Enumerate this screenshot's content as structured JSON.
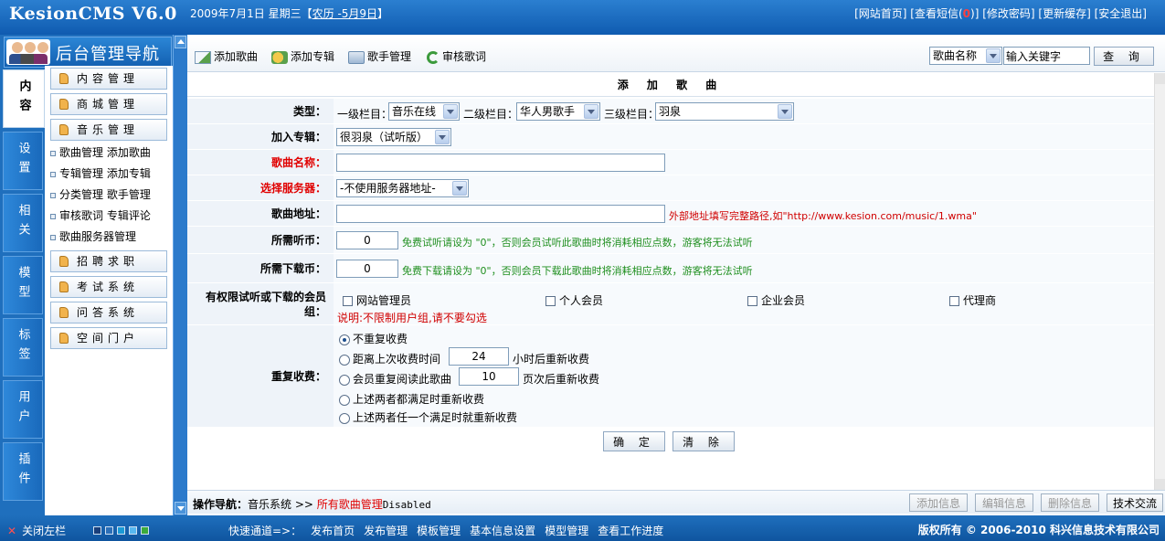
{
  "header": {
    "brand": "KesionCMS V6.0",
    "date": "2009年7月1日 星期三【",
    "lunar": "农历 -5月9日",
    "date_end": "】",
    "links": [
      "[网站首页]",
      "[查看短信(",
      "0",
      ")]",
      "[修改密码]",
      "[更新缓存]",
      "[安全退出]"
    ]
  },
  "leftnav": {
    "title": "后台管理导航",
    "tabs": [
      "内容",
      "设置",
      "相关",
      "模型",
      "标签",
      "用户",
      "插件"
    ],
    "sections": {
      "content": "内容管理",
      "shop": "商城管理",
      "music": "音乐管理",
      "jobs": "招聘求职",
      "exam": "考试系统",
      "qa": "问答系统",
      "space": "空间门户"
    },
    "music_items": [
      [
        "歌曲管理",
        "添加歌曲"
      ],
      [
        "专辑管理",
        "添加专辑"
      ],
      [
        "分类管理",
        "歌手管理"
      ],
      [
        "审核歌词",
        "专辑评论"
      ],
      [
        "歌曲服务器管理"
      ]
    ]
  },
  "toolbar": {
    "add_song": "添加歌曲",
    "add_album": "添加专辑",
    "singer": "歌手管理",
    "audit": "审核歌词",
    "search_field": "歌曲名称",
    "search_value": "输入关键字",
    "search_btn": "查 询"
  },
  "form": {
    "title": "添 加 歌 曲",
    "type_label": "类型：",
    "level1_label": "一级栏目：",
    "level1_value": "音乐在线",
    "level2_label": "二级栏目：",
    "level2_value": "华人男歌手",
    "level3_label": "三级栏目：",
    "level3_value": "羽泉",
    "album_label": "加入专辑：",
    "album_value": "很羽泉（试听版）",
    "name_label": "歌曲名称：",
    "server_label": "选择服务器：",
    "server_value": "-不使用服务器地址-",
    "url_label": "歌曲地址：",
    "url_hint": "外部地址填写完整路径,如\"http://www.kesion.com/music/1.wma\"",
    "listen_label": "所需听币：",
    "listen_value": "0",
    "listen_hint": "免费试听请设为 \"0\"，否则会员试听此歌曲时将消耗相应点数，游客将无法试听",
    "download_label": "所需下载币：",
    "download_value": "0",
    "download_hint": "免费下载请设为 \"0\"，否则会员下载此歌曲时将消耗相应点数，游客将无法试听",
    "groups_label": "有权限试听或下载的会员组：",
    "groups": [
      "网站管理员",
      "个人会员",
      "企业会员",
      "代理商"
    ],
    "groups_note": "说明:不限制用户组,请不要勾选",
    "repeat_label": "重复收费：",
    "repeat_options": {
      "none": "不重复收费",
      "hours_pre": "距离上次收费时间",
      "hours_value": "24",
      "hours_post": "小时后重新收费",
      "times_pre": "会员重复阅读此歌曲",
      "times_value": "10",
      "times_post": "页次后重新收费",
      "both": "上述两者都满足时重新收费",
      "either": "上述两者任一个满足时就重新收费"
    },
    "submit": "确 定",
    "clear": "清 除"
  },
  "opbar": {
    "label": "操作导航：",
    "path1": "音乐系统 >> ",
    "path2": "所有歌曲管理",
    "state": "Disabled",
    "buttons": [
      "添加信息",
      "编辑信息",
      "删除信息",
      "技术交流"
    ]
  },
  "bottombar": {
    "close": "关闭左栏",
    "swatch_colors": [
      "#1a3f7a",
      "#2b6fb8",
      "#1b9ad6",
      "#57b8f0",
      "#3cab3c"
    ],
    "quick_label": "快速通道=>：",
    "quick_links": [
      "发布首页",
      "发布管理",
      "模板管理",
      "基本信息设置",
      "模型管理",
      "查看工作进度"
    ],
    "copyright": "版权所有 © 2006-2010 科兴信息技术有限公司"
  }
}
